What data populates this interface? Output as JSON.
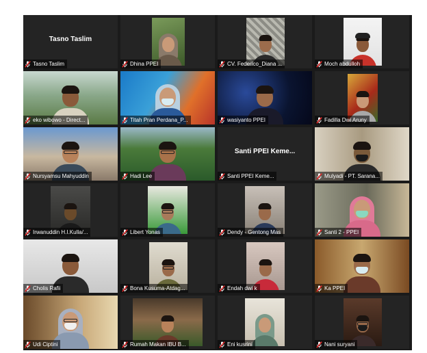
{
  "app": {
    "view": "gallery",
    "colors": {
      "background": "#1a1a1a",
      "tile": "#242424",
      "active_speaker": "#c8e25a",
      "muted_icon": "#e02828"
    }
  },
  "participants": [
    {
      "name": "Tasno Taslim",
      "muted": true,
      "video": false,
      "big_name": "Tasno Taslim"
    },
    {
      "name": "Dhina PPEI",
      "muted": true,
      "video": true,
      "scene": "hijab-woman-garden"
    },
    {
      "name": "CV. Federico_Diana ...",
      "muted": true,
      "video": true,
      "scene": "man-patterned-wall"
    },
    {
      "name": "Moch abdulloh",
      "muted": true,
      "video": true,
      "scene": "man-cap-red-shirt"
    },
    {
      "name": "eko wibowo - Direct...",
      "muted": true,
      "video": true,
      "scene": "man-mountain-background"
    },
    {
      "name": "Titah Pran Perdana_P...",
      "muted": true,
      "video": true,
      "scene": "woman-mask-colorful"
    },
    {
      "name": "wasiyanto PPEI",
      "muted": true,
      "video": true,
      "scene": "man-space-background"
    },
    {
      "name": "Fadilla Dwi Aruny",
      "muted": true,
      "video": true,
      "scene": "woman-painting"
    },
    {
      "name": "Nursyamsu Mahyuddin",
      "muted": true,
      "video": true,
      "scene": "man-glasses-city"
    },
    {
      "name": "Hadi Lee",
      "muted": true,
      "video": true,
      "scene": "man-borobudur"
    },
    {
      "name": "Santi PPEI Keme...",
      "muted": true,
      "video": false,
      "big_name": "Santi PPEI Keme..."
    },
    {
      "name": "Mulyadi - PT. Sarana...",
      "muted": true,
      "video": true,
      "scene": "man-mask-office"
    },
    {
      "name": "Irwanuddin H.I.Kulla/...",
      "muted": true,
      "video": true,
      "scene": "man-dark-room"
    },
    {
      "name": "Libert Yonas",
      "muted": true,
      "video": true,
      "scene": "man-glasses-green-logo"
    },
    {
      "name": "Dendy - Gentong Mas",
      "muted": true,
      "video": true,
      "scene": "man-office-wall"
    },
    {
      "name": "Santi 2 - PPEI",
      "muted": true,
      "video": true,
      "active": true,
      "scene": "hijab-woman-mask-green"
    },
    {
      "name": "Cholis Rafii",
      "muted": true,
      "video": true,
      "scene": "young-man-white-wall"
    },
    {
      "name": "Bona Kusuma-Atdag...",
      "muted": true,
      "video": true,
      "scene": "man-glasses-room"
    },
    {
      "name": "Endah dwi k",
      "muted": true,
      "video": true,
      "scene": "woman-red-shirt"
    },
    {
      "name": "Ka PPEI",
      "muted": true,
      "video": true,
      "scene": "man-mask-ornate"
    },
    {
      "name": "Udi Ciptini",
      "muted": true,
      "video": true,
      "scene": "hijab-woman-mask-glasses"
    },
    {
      "name": "Rumah Makan IBU B...",
      "muted": true,
      "video": true,
      "scene": "restaurant-interior"
    },
    {
      "name": "Eni kusrini",
      "muted": true,
      "video": true,
      "scene": "hijab-woman-ceiling"
    },
    {
      "name": "Nani suryani",
      "muted": true,
      "video": true,
      "scene": "woman-mask-dark"
    }
  ]
}
